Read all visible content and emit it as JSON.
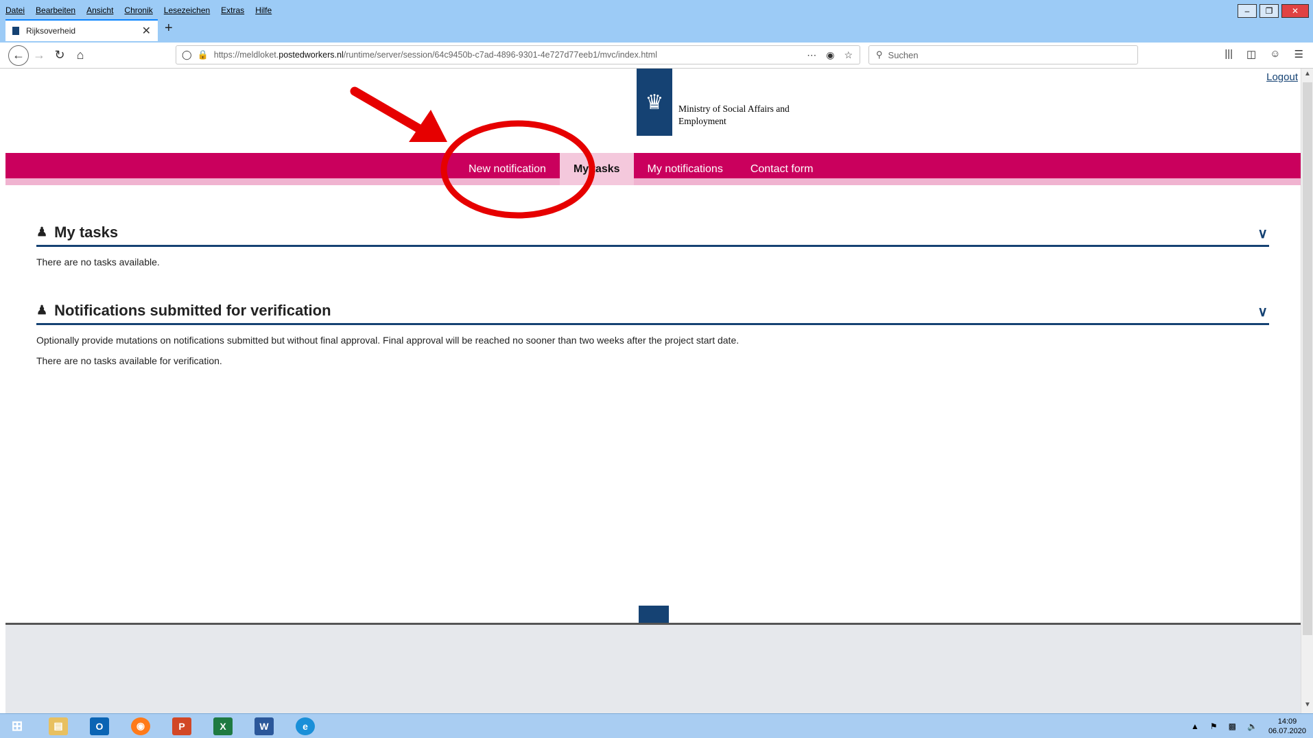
{
  "browser": {
    "menu": [
      "Datei",
      "Bearbeiten",
      "Ansicht",
      "Chronik",
      "Lesezeichen",
      "Extras",
      "Hilfe"
    ],
    "tab_title": "Rijksoverheid",
    "url_prefix": "https://meldloket.",
    "url_domain": "postedworkers.nl",
    "url_path": "/runtime/server/session/64c9450b-c7ad-4896-9301-4e727d77eeb1/mvc/index.html",
    "search_placeholder": "Suchen"
  },
  "page": {
    "logout": "Logout",
    "ministry": "Ministry of Social Affairs and Employment",
    "nav": [
      {
        "label": "New notification",
        "active": false
      },
      {
        "label": "My tasks",
        "active": true
      },
      {
        "label": "My notifications",
        "active": false
      },
      {
        "label": "Contact form",
        "active": false
      }
    ],
    "tasks_title": "My tasks",
    "tasks_empty": "There are no tasks available.",
    "verif_title": "Notifications submitted for verification",
    "verif_desc": "Optionally provide mutations on notifications submitted but without final approval. Final approval will be reached no sooner than two weeks after the project start date.",
    "verif_empty": "There are no tasks available for verification."
  },
  "colors": {
    "brand_pink": "#ca005d",
    "brand_blue": "#154273",
    "annotation_red": "#e60000"
  },
  "taskbar": {
    "time": "14:09",
    "date": "06.07.2020"
  }
}
